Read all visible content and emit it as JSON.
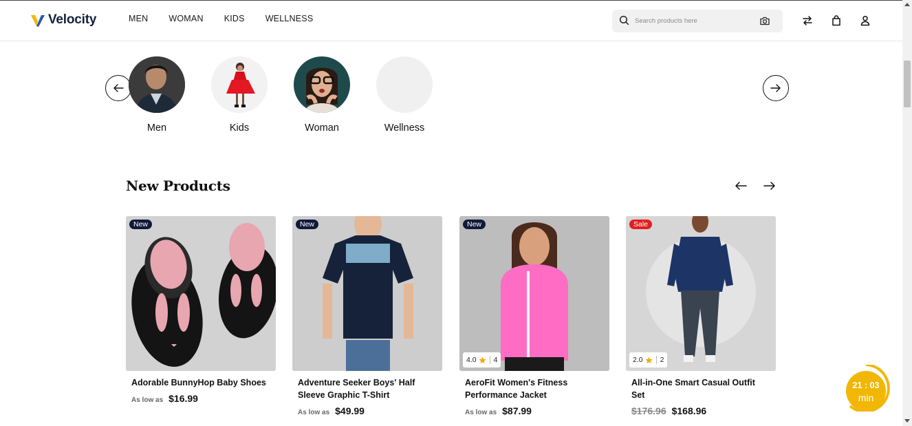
{
  "header": {
    "brand": "Velocity",
    "nav": [
      "MEN",
      "WOMAN",
      "KIDS",
      "WELLNESS"
    ],
    "search_placeholder": "Search products here"
  },
  "categories": [
    {
      "label": "Men"
    },
    {
      "label": "Kids"
    },
    {
      "label": "Woman"
    },
    {
      "label": "Wellness"
    }
  ],
  "new_products": {
    "title": "New Products",
    "items": [
      {
        "badge": "New",
        "name": "Adorable BunnyHop Baby Shoes",
        "as_low_as": "As low as",
        "price": "$16.99"
      },
      {
        "badge": "New",
        "name": "Adventure Seeker Boys' Half Sleeve Graphic T-Shirt",
        "as_low_as": "As low as",
        "price": "$49.99"
      },
      {
        "badge": "New",
        "name": "AeroFit Women's Fitness Performance Jacket",
        "as_low_as": "As low as",
        "price": "$87.99",
        "rating": "4.0",
        "reviews": "4"
      },
      {
        "badge": "Sale",
        "name": "All-in-One Smart Casual Outfit Set",
        "old_price": "$176.96",
        "price": "$168.96",
        "rating": "2.0",
        "reviews": "2"
      }
    ]
  },
  "timer": {
    "time": "21 : 03",
    "unit": "min"
  },
  "colors": {
    "brand_navy": "#14213d",
    "logo_accent": "#f2b705",
    "badge_new": "#111a3a",
    "badge_sale": "#e02020",
    "star": "#f2a900",
    "timer": "#f2b705"
  }
}
